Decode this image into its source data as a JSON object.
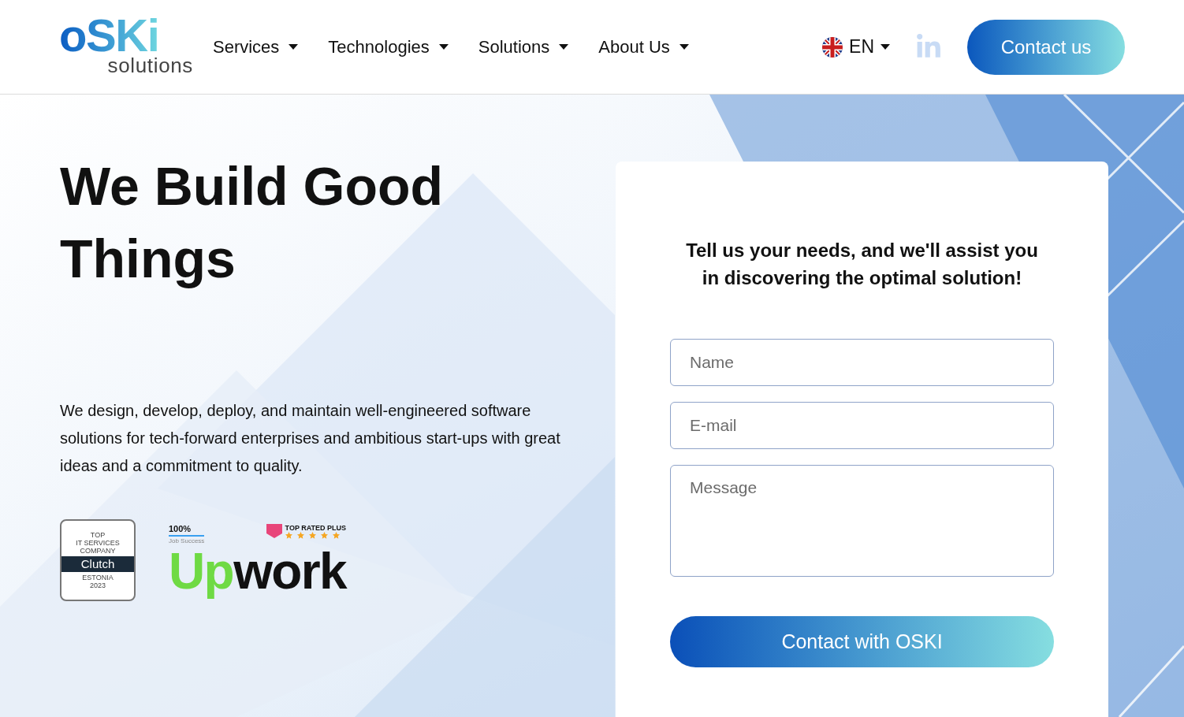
{
  "logo": {
    "mark": "oSKi",
    "tagline": "solutions"
  },
  "nav": [
    {
      "label": "Services"
    },
    {
      "label": "Technologies"
    },
    {
      "label": "Solutions"
    },
    {
      "label": "About Us"
    }
  ],
  "language": {
    "code": "EN"
  },
  "contact_button": "Contact us",
  "hero": {
    "title": "We Build Good Things",
    "description": "We design, develop, deploy, and maintain well-engineered software solutions for tech-forward enterprises and ambitious start-ups with great ideas and a commitment to quality."
  },
  "badges": {
    "clutch": {
      "top": "TOP",
      "line": "IT SERVICES",
      "line2": "COMPANY",
      "name": "Clutch",
      "country": "ESTONIA",
      "year": "2023"
    },
    "upwork": {
      "success": "100%",
      "success_label": "Job Success",
      "rating": "TOP RATED PLUS",
      "stars": 5,
      "brand_a": "Up",
      "brand_b": "work"
    }
  },
  "form": {
    "heading": "Tell us your needs, and we'll assist you in discovering the optimal solution!",
    "fields": [
      {
        "kind": "input",
        "placeholder": "Name"
      },
      {
        "kind": "input",
        "placeholder": "E-mail"
      },
      {
        "kind": "textarea",
        "placeholder": "Message"
      }
    ],
    "submit": "Contact with OSKI"
  }
}
